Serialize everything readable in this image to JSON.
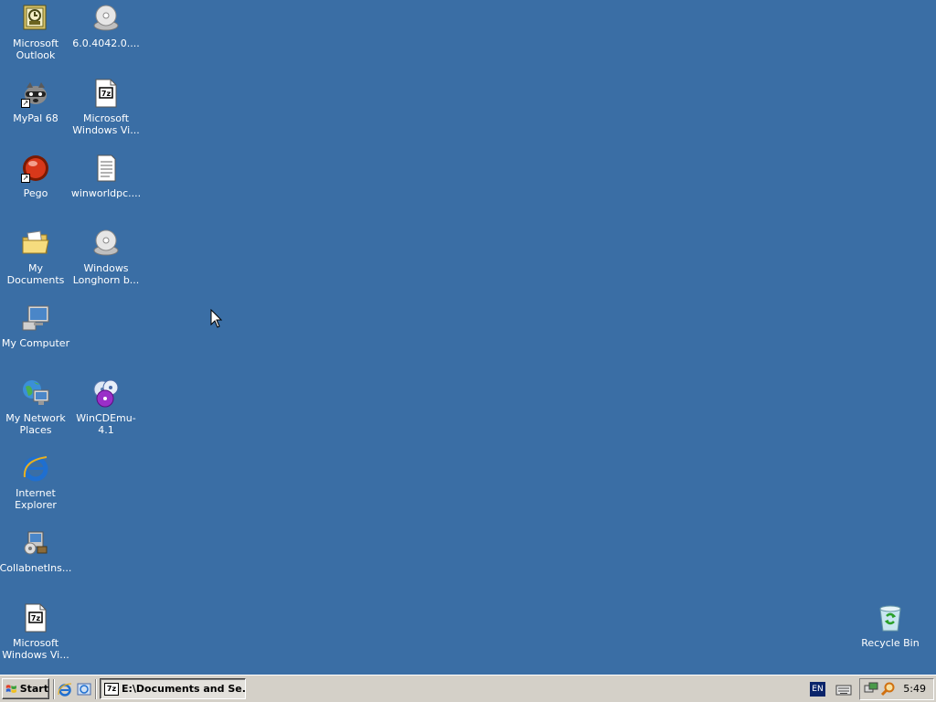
{
  "desktop": {
    "background": "#3a6ea5",
    "icons": {
      "outlook": "Microsoft\nOutlook",
      "disc1": "6.0.4042.0....",
      "mypal": "MyPal 68",
      "zip1": "Microsoft\nWindows Vi...",
      "pego": "Pego",
      "winworld": "winworldpc....",
      "mydocs": "My Documents",
      "longhorn": "Windows\nLonghorn b...",
      "mycomputer": "My Computer",
      "network": "My Network\nPlaces",
      "wincdemu": "WinCDEmu-4.1",
      "ie": "Internet\nExplorer",
      "collabnet": "CollabnetIns...",
      "zip2": "Microsoft\nWindows Vi...",
      "recycle": "Recycle Bin"
    },
    "archive_badge": "7z"
  },
  "taskbar": {
    "start_label": "Start",
    "task_label": "E:\\Documents and Se...",
    "task_badge": "7z",
    "language": "EN",
    "clock": "5:49"
  }
}
